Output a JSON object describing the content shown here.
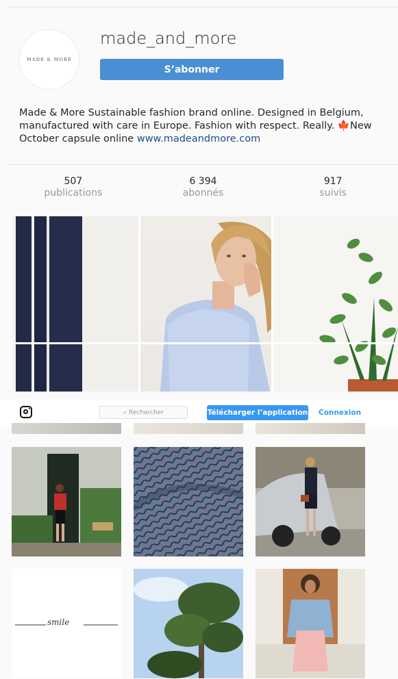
{
  "profile": {
    "username": "made_and_more",
    "avatar_text": "MADE & MORE",
    "follow_label": "S’abonner",
    "bio_text": "Made & More Sustainable fashion brand online. Designed in Belgium, manufactured with care in Europe. Fashion with respect. Really. ",
    "bio_emoji": "🍁",
    "bio_text_2": "New October capsule online ",
    "bio_link": "www.madeandmore.com"
  },
  "stats": [
    {
      "value": "507",
      "label": "publications"
    },
    {
      "value": "6 394",
      "label": "abonnés"
    },
    {
      "value": "917",
      "label": "suivis"
    }
  ],
  "navbar": {
    "logo_icon": "instagram-icon",
    "search_placeholder": "⌕ Rechercher",
    "download_label": "Télécharger l’application",
    "login_label": "Connexion"
  },
  "posts": [
    {
      "caption": "smile"
    }
  ]
}
